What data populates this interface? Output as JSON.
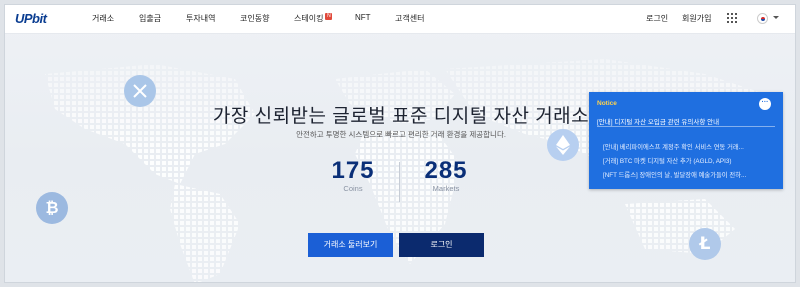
{
  "header": {
    "logo": "UPbit",
    "nav": [
      "거래소",
      "입출금",
      "투자내역",
      "코인동향",
      "스테이킹",
      "NFT",
      "고객센터"
    ],
    "staking_badge": "N",
    "login": "로그인",
    "signup": "회원가입"
  },
  "hero": {
    "title": "가장 신뢰받는 글로벌 표준 디지털 자산 거래소",
    "subtitle": "안전하고 투명한 시스템으로 빠르고 편리한 거래 환경을 제공합니다.",
    "coins_value": "175",
    "coins_label": "Coins",
    "markets_value": "285",
    "markets_label": "Markets",
    "browse_button": "거래소 둘러보기",
    "login_button": "로그인"
  },
  "notice": {
    "heading": "Notice",
    "more": "···",
    "main": "[안내] 디지털 자산 오입금 관련 유의사항 안내",
    "items": [
      "[안내] 베리파이에스프 계정주 확인 서비스 연동 거래...",
      "[거래] BTC 마켓 디지털 자산 추가 (AGLD, API3)",
      "[NFT 드롭스] 장애인의 날, 발달장애 예술가들이 전하..."
    ]
  },
  "colors": {
    "brand_navy": "#0a2f78",
    "accent_blue": "#1b5fd6",
    "notice_bg": "#1f6fe0",
    "notice_heading": "#ffd34d",
    "badge_red": "#e1493a"
  },
  "icons": [
    "xrp-coin-icon",
    "bitcoin-coin-icon",
    "ethereum-coin-icon",
    "litecoin-coin-icon",
    "apps-grid-icon",
    "korea-flag-icon",
    "chevron-down-icon",
    "more-icon"
  ]
}
